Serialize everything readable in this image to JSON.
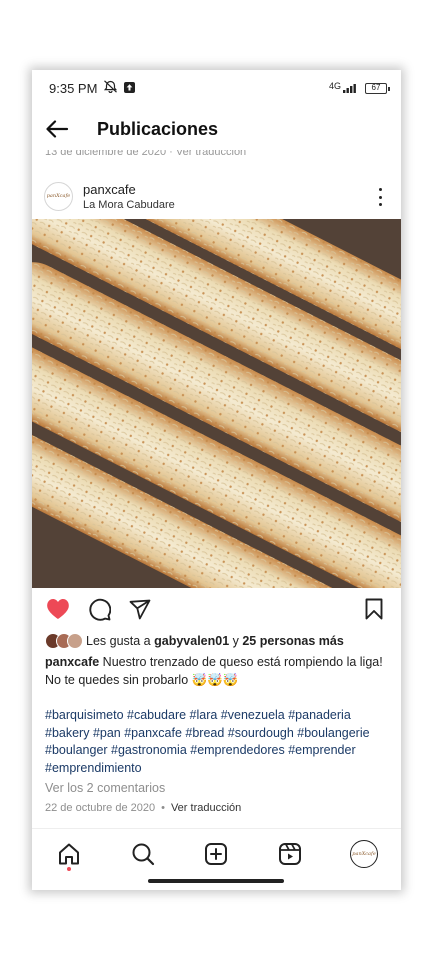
{
  "status_bar": {
    "time": "9:35 PM",
    "network": "4G",
    "battery": "67"
  },
  "header": {
    "title": "Publicaciones"
  },
  "previous_post": {
    "partial_text": "13 de diciembre de 2020 · Ver traducción"
  },
  "post": {
    "username": "panxcafe",
    "location": "La Mora Cabudare",
    "avatar_text": "panXcafe",
    "liked": true,
    "likes": {
      "prefix": "Les gusta a ",
      "user": "gabyvalen01",
      "connector": " y ",
      "others": "25 personas más"
    },
    "caption": {
      "user": "panxcafe",
      "text": " Nuestro trenzado de queso está rompiendo la liga! No te quedes sin probarlo 🤯🤯🤯"
    },
    "hashtags": "#barquisimeto #cabudare #lara #venezuela #panaderia #bakery #pan #panxcafe #bread #sourdough #boulangerie #boulanger #gastronomia #emprendedores #emprender #emprendimiento",
    "comments_link": "Ver los 2 comentarios",
    "date": "22 de octubre de 2020",
    "separator": "•",
    "translate": "Ver traducción"
  },
  "nav": {
    "profile_avatar_text": "panXcafe"
  },
  "colors": {
    "like": "#ed4956",
    "hashtag": "#1b3a66",
    "muted": "#8e8e8e"
  }
}
